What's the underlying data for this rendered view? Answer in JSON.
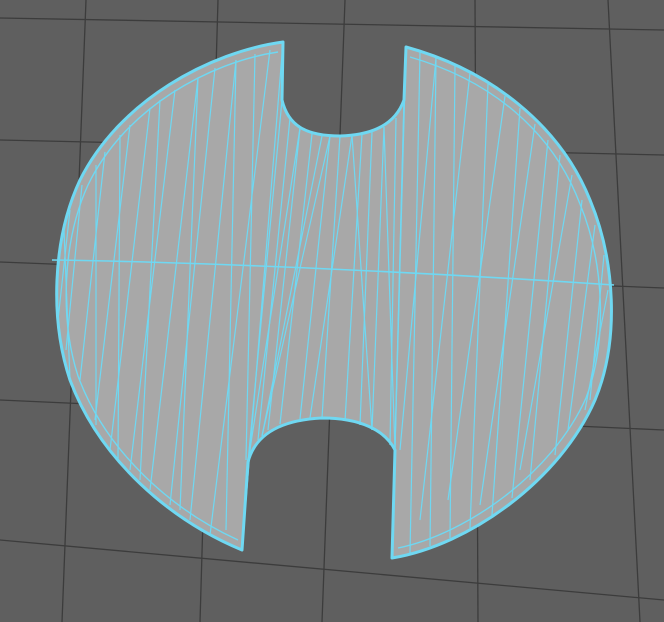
{
  "viewport": {
    "background_color": "#5f5f5f",
    "grid_color": "#3c3c3c",
    "selection_color": "#6fd8f2",
    "mesh_fill_color": "#a8a8a8",
    "mesh_state": "selected-wireframe-on-shaded"
  }
}
